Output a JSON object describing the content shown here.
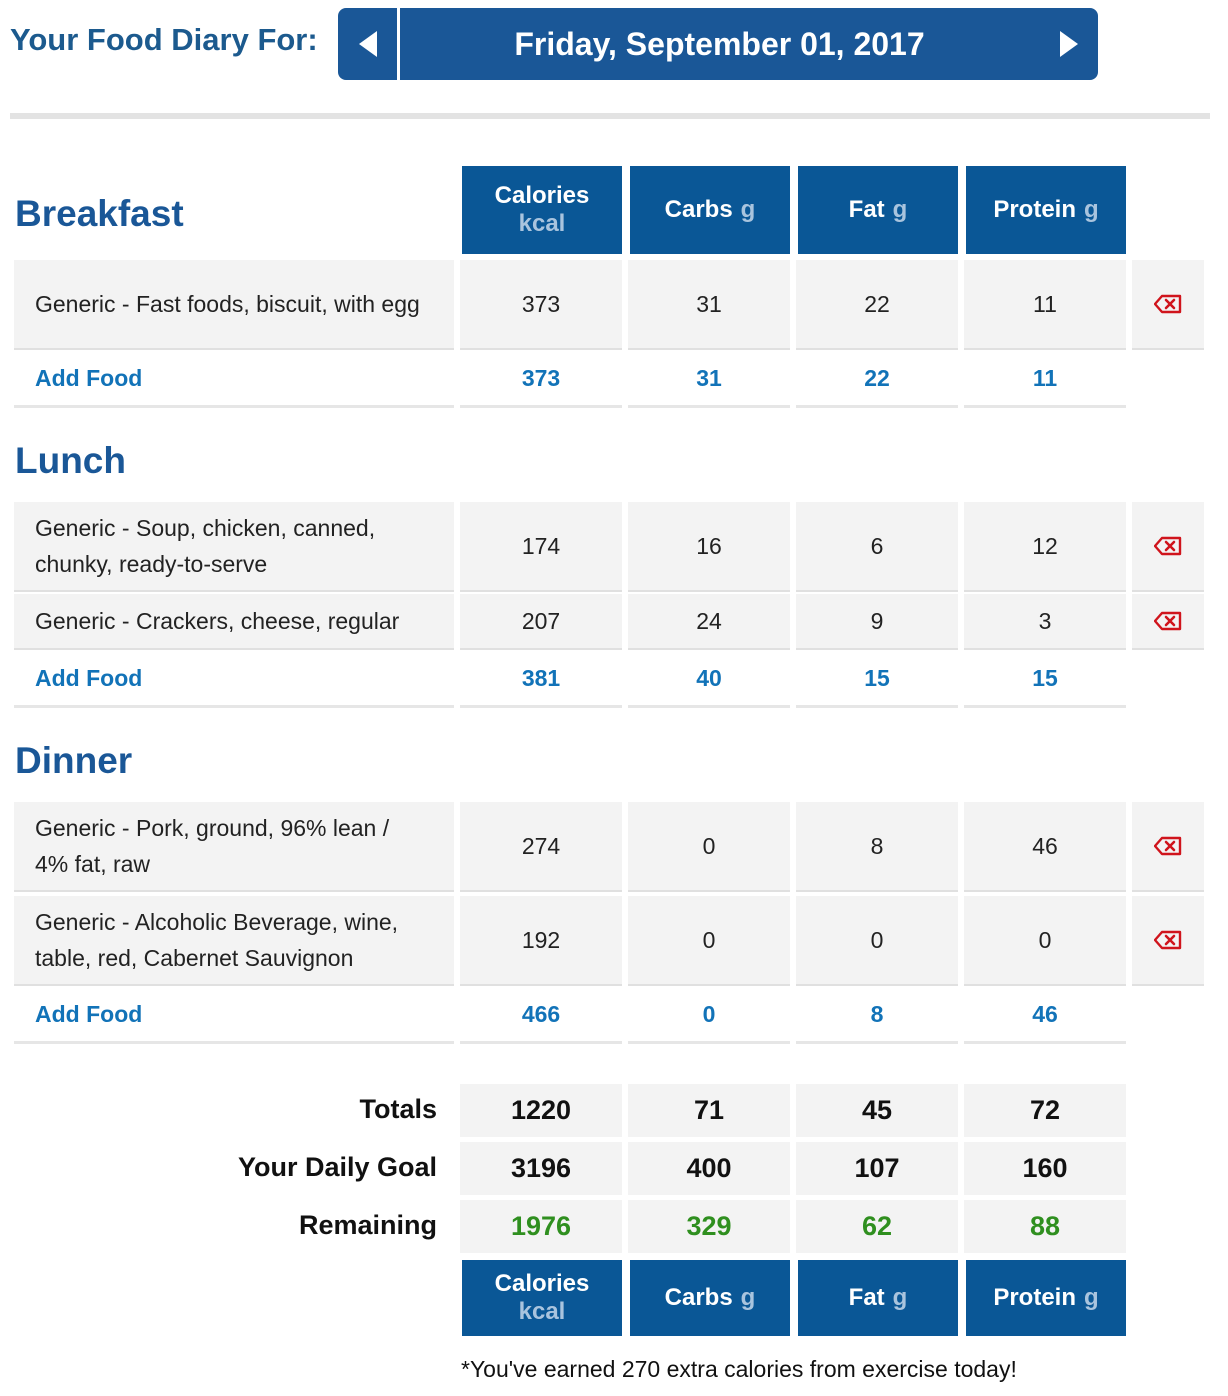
{
  "header": {
    "title": "Your Food Diary For:",
    "date": "Friday, September 01, 2017"
  },
  "columns": {
    "calories": {
      "label": "Calories",
      "unit": "kcal"
    },
    "carbs": {
      "label": "Carbs",
      "unit": "g"
    },
    "fat": {
      "label": "Fat",
      "unit": "g"
    },
    "protein": {
      "label": "Protein",
      "unit": "g"
    }
  },
  "add_food_label": "Add Food",
  "breakfast": {
    "title": "Breakfast",
    "items": [
      {
        "name": "Generic - Fast foods, biscuit, with egg",
        "calories": "373",
        "carbs": "31",
        "fat": "22",
        "protein": "11"
      }
    ],
    "totals": {
      "calories": "373",
      "carbs": "31",
      "fat": "22",
      "protein": "11"
    }
  },
  "lunch": {
    "title": "Lunch",
    "items": [
      {
        "name": "Generic - Soup, chicken, canned, chunky, ready-to-serve",
        "calories": "174",
        "carbs": "16",
        "fat": "6",
        "protein": "12"
      },
      {
        "name": "Generic - Crackers, cheese, regular",
        "calories": "207",
        "carbs": "24",
        "fat": "9",
        "protein": "3"
      }
    ],
    "totals": {
      "calories": "381",
      "carbs": "40",
      "fat": "15",
      "protein": "15"
    }
  },
  "dinner": {
    "title": "Dinner",
    "items": [
      {
        "name": "Generic - Pork, ground, 96% lean / 4% fat, raw",
        "calories": "274",
        "carbs": "0",
        "fat": "8",
        "protein": "46"
      },
      {
        "name": "Generic - Alcoholic Beverage, wine, table, red, Cabernet Sauvignon",
        "calories": "192",
        "carbs": "0",
        "fat": "0",
        "protein": "0"
      }
    ],
    "totals": {
      "calories": "466",
      "carbs": "0",
      "fat": "8",
      "protein": "46"
    }
  },
  "summary": {
    "totals": {
      "label": "Totals",
      "calories": "1220",
      "carbs": "71",
      "fat": "45",
      "protein": "72"
    },
    "goal": {
      "label": "Your Daily Goal",
      "calories": "3196",
      "carbs": "400",
      "fat": "107",
      "protein": "160"
    },
    "remaining": {
      "label": "Remaining",
      "calories": "1976",
      "carbs": "329",
      "fat": "62",
      "protein": "88"
    }
  },
  "exercise_note": "*You've earned 270 extra calories from exercise today!",
  "colors": {
    "header_blue": "#1a5797",
    "link_blue": "#1273b8",
    "remaining_green": "#2f8f1f",
    "delete_red": "#d0141c"
  },
  "icons": {
    "prev": "triangle-left-icon",
    "next": "triangle-right-icon",
    "delete": "delete-backspace-icon"
  }
}
